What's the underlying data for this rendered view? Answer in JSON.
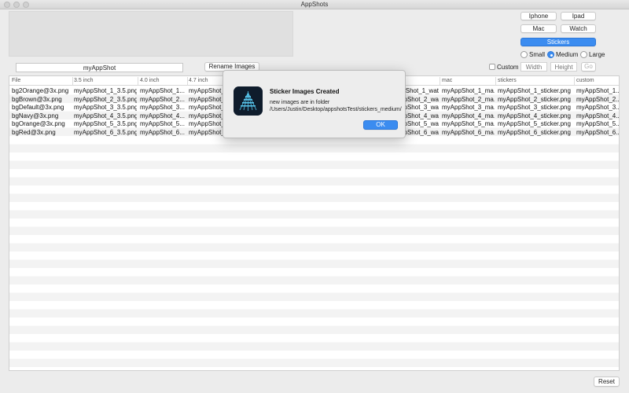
{
  "window": {
    "title": "AppShots"
  },
  "device_buttons": {
    "iphone": "Iphone",
    "ipad": "Ipad",
    "mac": "Mac",
    "watch": "Watch",
    "stickers": "Stickers"
  },
  "size_options": {
    "small": "Small",
    "medium": "Medium",
    "large": "Large",
    "selected": "Medium"
  },
  "name_field": {
    "value": "myAppShot"
  },
  "rename_button": "Rename Images",
  "custom": {
    "label": "Custom",
    "checked": false,
    "width_placeholder": "Width",
    "height_placeholder": "Height",
    "go_label": "Go"
  },
  "table": {
    "columns": [
      "File",
      "3.5 inch",
      "4.0 inch",
      "4.7 inch",
      "",
      "",
      "mac",
      "stickers",
      "custom"
    ],
    "rows": [
      [
        "bg2Orange@3x.png",
        "myAppShot_1_3.5.png",
        "myAppShot_1...",
        "myAppShot_1",
        "",
        "myAppShot_1_wat...",
        "myAppShot_1_ma...",
        "myAppShot_1_sticker.png",
        "myAppShot_1..."
      ],
      [
        "bgBrown@3x.png",
        "myAppShot_2_3.5.png",
        "myAppShot_2...",
        "myAppShot_2",
        "",
        "myAppShot_2_wa...",
        "myAppShot_2_ma...",
        "myAppShot_2_sticker.png",
        "myAppShot_2..."
      ],
      [
        "bgDefault@3x.png",
        "myAppShot_3_3.5.png",
        "myAppShot_3...",
        "myAppShot_3",
        "",
        "myAppShot_3_wa...",
        "myAppShot_3_ma...",
        "myAppShot_3_sticker.png",
        "myAppShot_3..."
      ],
      [
        "bgNavy@3x.png",
        "myAppShot_4_3.5.png",
        "myAppShot_4...",
        "myAppShot_4",
        "",
        "myAppShot_4_wa...",
        "myAppShot_4_ma...",
        "myAppShot_4_sticker.png",
        "myAppShot_4..."
      ],
      [
        "bgOrange@3x.png",
        "myAppShot_5_3.5.png",
        "myAppShot_5...",
        "myAppShot_5",
        "",
        "myAppShot_5_wa...",
        "myAppShot_5_ma...",
        "myAppShot_5_sticker.png",
        "myAppShot_5..."
      ],
      [
        "bgRed@3x.png",
        "myAppShot_6_3.5.png",
        "myAppShot_6...",
        "myAppShot_6",
        "",
        "myAppShot_6_wa...",
        "myAppShot_6_ma...",
        "myAppShot_6_sticker.png",
        "myAppShot_6..."
      ]
    ]
  },
  "reset_button": "Reset",
  "dialog": {
    "title": "Sticker Images Created",
    "message": "new images are in folder /Users/Justin/Desktop/appshotsTest/stickers_medium/",
    "ok_label": "OK",
    "icon": "appshots-app-icon"
  },
  "colors": {
    "accent": "#3b8cf0",
    "window_bg": "#ececec",
    "row_stripe": "#f3f3f3"
  }
}
